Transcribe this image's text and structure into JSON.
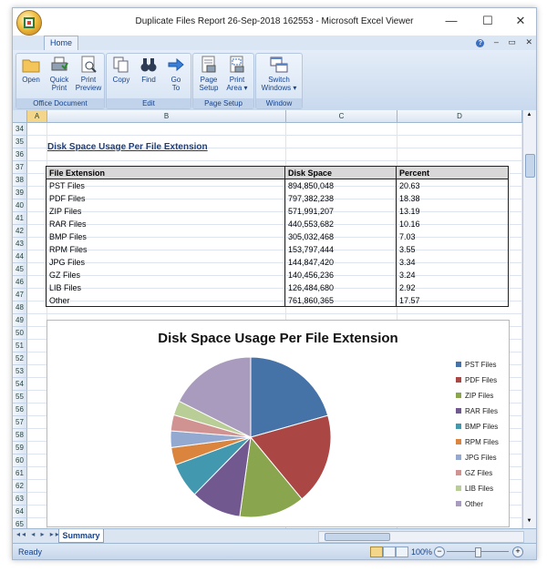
{
  "window": {
    "title": "Duplicate Files Report 26-Sep-2018 162553 - Microsoft Excel Viewer"
  },
  "ribbon": {
    "tab": "Home",
    "groups": [
      {
        "label": "Office Document",
        "buttons": [
          {
            "label1": "Open",
            "label2": ""
          },
          {
            "label1": "Quick",
            "label2": "Print"
          },
          {
            "label1": "Print",
            "label2": "Preview"
          }
        ]
      },
      {
        "label": "Edit",
        "buttons": [
          {
            "label1": "Copy",
            "label2": ""
          },
          {
            "label1": "Find",
            "label2": ""
          },
          {
            "label1": "Go",
            "label2": "To"
          }
        ]
      },
      {
        "label": "Page Setup",
        "buttons": [
          {
            "label1": "Page",
            "label2": "Setup"
          },
          {
            "label1": "Print",
            "label2": "Area ▾"
          }
        ]
      },
      {
        "label": "Window",
        "buttons": [
          {
            "label1": "Switch",
            "label2": "Windows ▾"
          }
        ]
      }
    ]
  },
  "columns": [
    "A",
    "B",
    "C",
    "D"
  ],
  "rows": [
    "34",
    "35",
    "36",
    "37",
    "38",
    "39",
    "40",
    "41",
    "42",
    "43",
    "44",
    "45",
    "46",
    "47",
    "48",
    "49",
    "50",
    "51",
    "52",
    "53",
    "54",
    "55",
    "56",
    "57",
    "58",
    "59",
    "60",
    "61",
    "62",
    "63",
    "64",
    "65"
  ],
  "section_title": "Disk Space Usage Per File Extension",
  "table": {
    "headers": [
      "File Extension",
      "Disk Space",
      "Percent"
    ],
    "rows": [
      [
        "PST Files",
        "894,850,048",
        "20.63"
      ],
      [
        "PDF Files",
        "797,382,238",
        "18.38"
      ],
      [
        "ZIP Files",
        "571,991,207",
        "13.19"
      ],
      [
        "RAR Files",
        "440,553,682",
        "10.16"
      ],
      [
        "BMP Files",
        "305,032,468",
        "7.03"
      ],
      [
        "RPM Files",
        "153,797,444",
        "3.55"
      ],
      [
        "JPG Files",
        "144,847,420",
        "3.34"
      ],
      [
        "GZ Files",
        "140,456,236",
        "3.24"
      ],
      [
        "LIB Files",
        "126,484,680",
        "2.92"
      ],
      [
        "Other",
        "761,860,365",
        "17.57"
      ]
    ]
  },
  "chart_data": {
    "type": "pie",
    "title": "Disk Space Usage Per File Extension",
    "categories": [
      "PST Files",
      "PDF Files",
      "ZIP Files",
      "RAR Files",
      "BMP Files",
      "RPM Files",
      "JPG Files",
      "GZ Files",
      "LIB Files",
      "Other"
    ],
    "values": [
      20.63,
      18.38,
      13.19,
      10.16,
      7.03,
      3.55,
      3.34,
      3.24,
      2.92,
      17.57
    ],
    "colors": [
      "#4572a7",
      "#aa4643",
      "#89a54e",
      "#71588f",
      "#4198af",
      "#db843d",
      "#93a9cf",
      "#d19392",
      "#b9cd96",
      "#a99bbd"
    ],
    "legend": "right"
  },
  "sheet_tabs": [
    "Summary"
  ],
  "status": {
    "ready": "Ready",
    "zoom": "100%"
  }
}
